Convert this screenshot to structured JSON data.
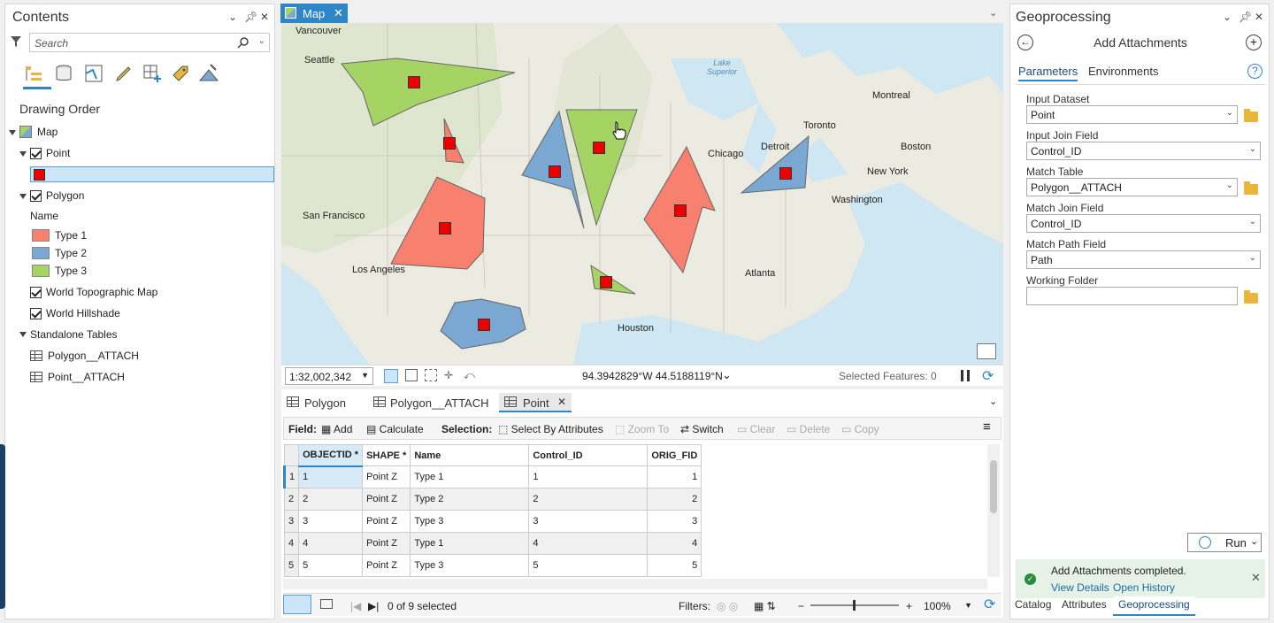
{
  "contents": {
    "title": "Contents",
    "search_placeholder": "Search",
    "drawing_order": "Drawing Order",
    "map": "Map",
    "point": "Point",
    "polygon": "Polygon",
    "name_header": "Name",
    "types": [
      "Type 1",
      "Type 2",
      "Type 3"
    ],
    "type_colors": [
      "#f8806e",
      "#7aa8d2",
      "#a5d465"
    ],
    "basemap1": "World Topographic Map",
    "basemap2": "World Hillshade",
    "standalone": "Standalone Tables",
    "table1": "Polygon__ATTACH",
    "table2": "Point__ATTACH"
  },
  "map": {
    "tab": "Map",
    "cities": [
      "Vancouver",
      "Seattle",
      "San Francisco",
      "Los Angeles",
      "Houston",
      "Atlanta",
      "Washington",
      "New York",
      "Boston",
      "Toronto",
      "Montreal",
      "Detroit",
      "Chicago"
    ],
    "lake": "Lake Superior",
    "scale": "1:32,002,342",
    "coords": "94.3942829°W 44.5188119°N",
    "selected": "Selected Features: 0"
  },
  "attr": {
    "tabs": [
      "Polygon",
      "Polygon__ATTACH",
      "Point"
    ],
    "field_label": "Field:",
    "add": "Add",
    "calculate": "Calculate",
    "selection_label": "Selection:",
    "select_by": "Select By Attributes",
    "zoom_to": "Zoom To",
    "switch": "Switch",
    "clear": "Clear",
    "delete": "Delete",
    "copy": "Copy",
    "columns": [
      "OBJECTID *",
      "SHAPE *",
      "Name",
      "Control_ID",
      "ORIG_FID"
    ],
    "rows": [
      [
        "1",
        "1",
        "Point Z",
        "Type 1",
        "1",
        "1"
      ],
      [
        "2",
        "2",
        "Point Z",
        "Type 2",
        "2",
        "2"
      ],
      [
        "3",
        "3",
        "Point Z",
        "Type 3",
        "3",
        "3"
      ],
      [
        "4",
        "4",
        "Point Z",
        "Type 1",
        "4",
        "4"
      ],
      [
        "5",
        "5",
        "Point Z",
        "Type 3",
        "5",
        "5"
      ]
    ],
    "selected_count": "0 of 9 selected",
    "filters": "Filters:",
    "zoom": "100%"
  },
  "gp": {
    "title": "Geoprocessing",
    "tool": "Add Attachments",
    "tab_params": "Parameters",
    "tab_env": "Environments",
    "input_dataset_label": "Input Dataset",
    "input_dataset": "Point",
    "input_join_label": "Input Join Field",
    "input_join": "Control_ID",
    "match_table_label": "Match Table",
    "match_table": "Polygon__ATTACH",
    "match_join_label": "Match Join Field",
    "match_join": "Control_ID",
    "match_path_label": "Match Path Field",
    "match_path": "Path",
    "working_label": "Working Folder",
    "working": "",
    "run": "Run",
    "status": "Add Attachments completed.",
    "view_details": "View Details",
    "open_history": "Open History"
  },
  "bottom_tabs": [
    "Catalog",
    "Attributes",
    "Geoprocessing"
  ]
}
